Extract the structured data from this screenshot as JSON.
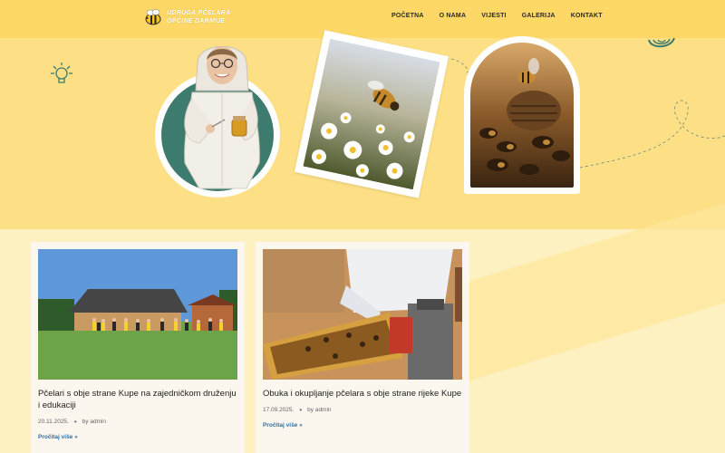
{
  "header": {
    "logo_line1": "UDRUGA PČELARA",
    "logo_line2": "OPĆINE DARMIJE",
    "nav": [
      {
        "label": "POČETNA"
      },
      {
        "label": "O NAMA"
      },
      {
        "label": "VIJESTI"
      },
      {
        "label": "GALERIJA"
      },
      {
        "label": "KONTAKT"
      }
    ]
  },
  "hero": {
    "portrait_alt": "Pčelarica u zaštitnom odijelu",
    "bee_flower_alt": "Pčela na tratinčici",
    "bee_comb_alt": "Pčele na saću"
  },
  "posts": [
    {
      "title": "Pčelari s obje strane Kupe na zajedničkom druženju i edukaciji",
      "date": "20.11.2025.",
      "author": "by admin",
      "more": "Pročitaj više »"
    },
    {
      "title": "Obuka i okupljanje pčelara s obje strane rijeke Kupe",
      "date": "17.09.2025.",
      "author": "by admin",
      "more": "Pročitaj više »"
    }
  ],
  "colors": {
    "header": "#fdd866",
    "hero": "#fde086",
    "page": "#fdf1c2",
    "accent_teal": "#3c7b6d",
    "link": "#2b6fa8"
  }
}
